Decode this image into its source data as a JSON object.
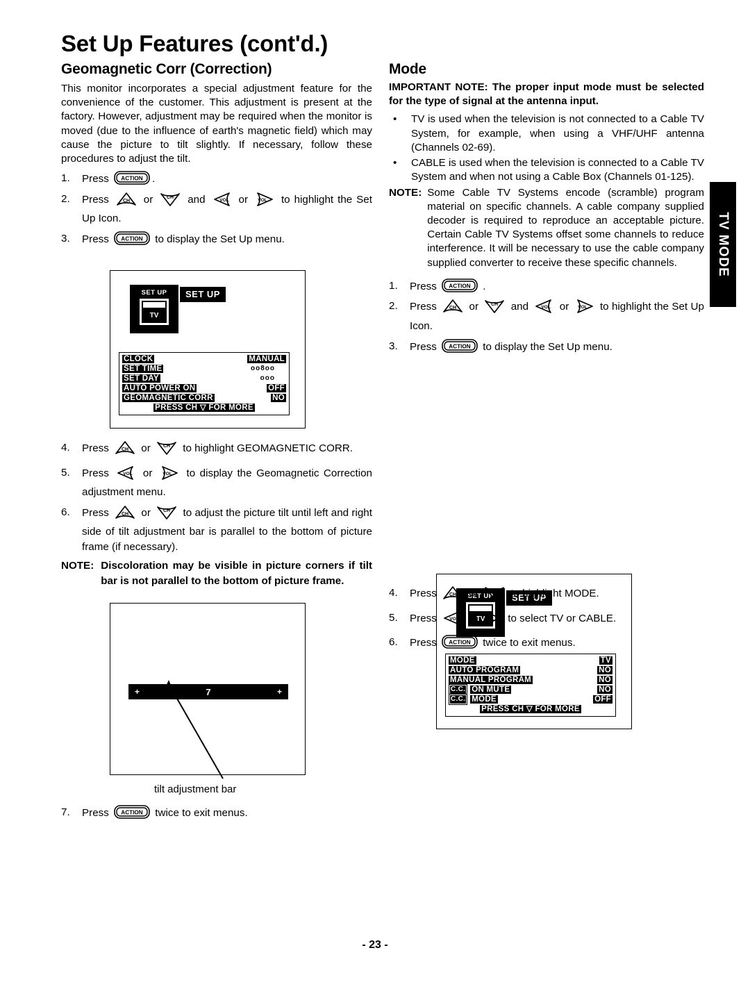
{
  "document": {
    "title": "Set Up Features (cont'd.)",
    "page_number": "- 23 -",
    "side_tab": "TV MODE"
  },
  "left_column": {
    "heading": "Geomagnetic Corr (Correction)",
    "intro": "This monitor incorporates a special adjustment feature for the convenience of the customer. This adjustment is present at the factory. However, adjustment may be required when the monitor is moved (due to the influence of earth's magnetic field) which may cause the picture to tilt slightly. If necessary, follow these procedures to adjust the tilt.",
    "steps": [
      {
        "num": "1.",
        "pre": "Press",
        "post": "."
      },
      {
        "num": "2.",
        "pre": "Press",
        "mid": "or",
        "mid2": "and",
        "mid3": "or",
        "post": "to highlight the Set Up Icon."
      },
      {
        "num": "3.",
        "pre": "Press",
        "post": "to display the Set Up menu."
      },
      {
        "num": "4.",
        "pre": "Press",
        "mid": "or",
        "post": "to highlight GEOMAGNETIC CORR."
      },
      {
        "num": "5.",
        "pre": "Press",
        "mid": "or",
        "post": "to display the Geomagnetic Correction adjustment menu."
      },
      {
        "num": "6.",
        "pre": "Press",
        "mid": "or",
        "post": "to adjust the picture tilt until left and right side of tilt adjustment bar is parallel to the bottom of picture frame (if necessary)."
      },
      {
        "num": "7.",
        "pre": "Press",
        "post": "twice to exit menus."
      }
    ],
    "note": {
      "label": "NOTE:",
      "text": "Discoloration may be visible in picture corners if tilt bar is not parallel to the bottom of picture frame."
    },
    "tilt_illustration": {
      "left_marker": "+",
      "center_value": "7",
      "right_marker": "+",
      "caption": "tilt adjustment bar"
    }
  },
  "right_column": {
    "heading": "Mode",
    "important_note": {
      "label": "IMPORTANT NOTE:",
      "text": "The proper input mode must be selected for the type of signal at the antenna input."
    },
    "bullets": [
      "TV is used when the television is not connected to a Cable TV System, for example, when using a VHF/UHF antenna (Channels 02-69).",
      "CABLE is used when the television is connected to a Cable TV System and when not using a Cable Box (Channels 01-125)."
    ],
    "note": {
      "label": "NOTE:",
      "text": "Some Cable TV Systems encode (scramble) program material on specific channels. A cable company supplied decoder is required to reproduce an acceptable picture. Certain Cable TV Systems offset some channels to reduce interference. It will be necessary to use the cable company supplied converter to receive these specific channels."
    },
    "steps": [
      {
        "num": "1.",
        "pre": "Press",
        "post": "."
      },
      {
        "num": "2.",
        "pre": "Press",
        "mid": "or",
        "mid2": "and",
        "mid3": "or",
        "post": "to highlight the Set Up Icon."
      },
      {
        "num": "3.",
        "pre": "Press",
        "post": "to display the Set Up menu."
      },
      {
        "num": "4.",
        "pre": "Press",
        "mid": "or",
        "post": "to highlight MODE."
      },
      {
        "num": "5.",
        "pre": "Press",
        "mid": "or",
        "post": "to select TV or CABLE."
      },
      {
        "num": "6.",
        "pre": "Press",
        "post": "twice to exit menus."
      }
    ]
  },
  "osd_setup_menu": {
    "icon_caption": "SET UP",
    "icon_tv_label": "TV",
    "title": "SET UP",
    "rows": [
      {
        "label": "CLOCK",
        "value": "MANUAL",
        "dots": "",
        "highlight": false
      },
      {
        "label": "SET TIME",
        "value": "",
        "dots": "oo8oo",
        "highlight": false
      },
      {
        "label": "SET DAY",
        "value": "",
        "dots": "ooo",
        "highlight": false
      },
      {
        "label": "AUTO POWER ON",
        "value": "OFF",
        "dots": "",
        "highlight": false
      },
      {
        "label": "GEOMAGNETIC CORR",
        "value": "NO",
        "dots": "",
        "highlight": true
      }
    ],
    "footer": "PRESS CH ▽ FOR MORE"
  },
  "osd_mode_menu": {
    "icon_caption": "SET UP",
    "icon_tv_label": "TV",
    "title": "SET UP",
    "rows": [
      {
        "tag": "",
        "label": "MODE",
        "value": "TV",
        "highlight": true
      },
      {
        "tag": "",
        "label": "AUTO PROGRAM",
        "value": "NO",
        "highlight": false
      },
      {
        "tag": "",
        "label": "MANUAL PROGRAM",
        "value": "NO",
        "highlight": false
      },
      {
        "tag": "C.C.",
        "label": "ON MUTE",
        "value": "NO",
        "highlight": false
      },
      {
        "tag": "C.C.",
        "label": "MODE",
        "value": "OFF",
        "highlight": false
      }
    ],
    "footer": "PRESS CH ▽ FOR MORE"
  },
  "icons": {
    "action_key": "ACTION",
    "ch_up": "CH",
    "ch_down": "CH",
    "vol_left": "VOL",
    "vol_right": "VOL"
  }
}
